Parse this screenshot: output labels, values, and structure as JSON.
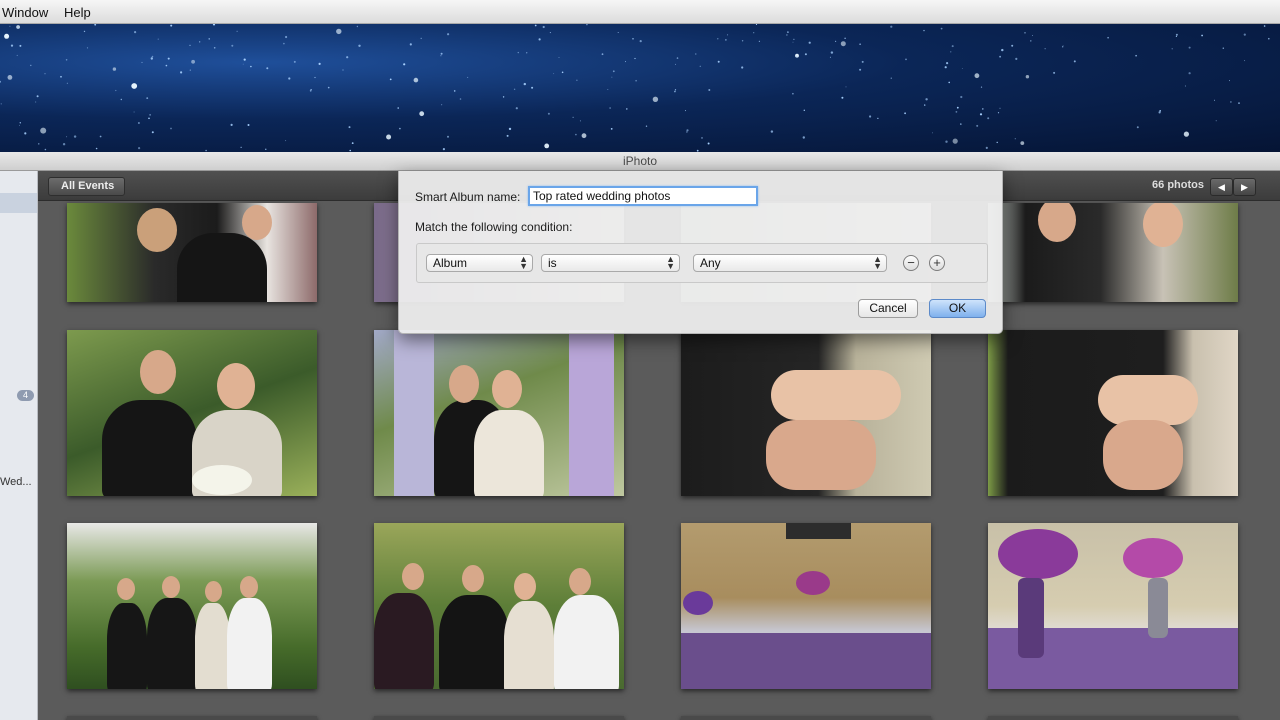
{
  "menubar": {
    "items": [
      "Window",
      "Help"
    ]
  },
  "window": {
    "title": "iPhoto"
  },
  "sidebar": {
    "truncated_label": "Wed...",
    "badge": "4"
  },
  "toolbar": {
    "back_label": "All Events",
    "photo_count": "66 photos",
    "prev_icon": "◀",
    "next_icon": "▶"
  },
  "dialog": {
    "name_label": "Smart Album name:",
    "name_value": "Top rated wedding photos",
    "match_label": "Match the following condition:",
    "condition": {
      "field": "Album",
      "operator": "is",
      "value": "Any"
    },
    "remove_symbol": "−",
    "add_symbol": "+",
    "cancel_label": "Cancel",
    "ok_label": "OK"
  },
  "colors": {
    "accent": "#6aa5e9",
    "toolbar": "#454545",
    "grid_bg": "#5b5b5b"
  }
}
